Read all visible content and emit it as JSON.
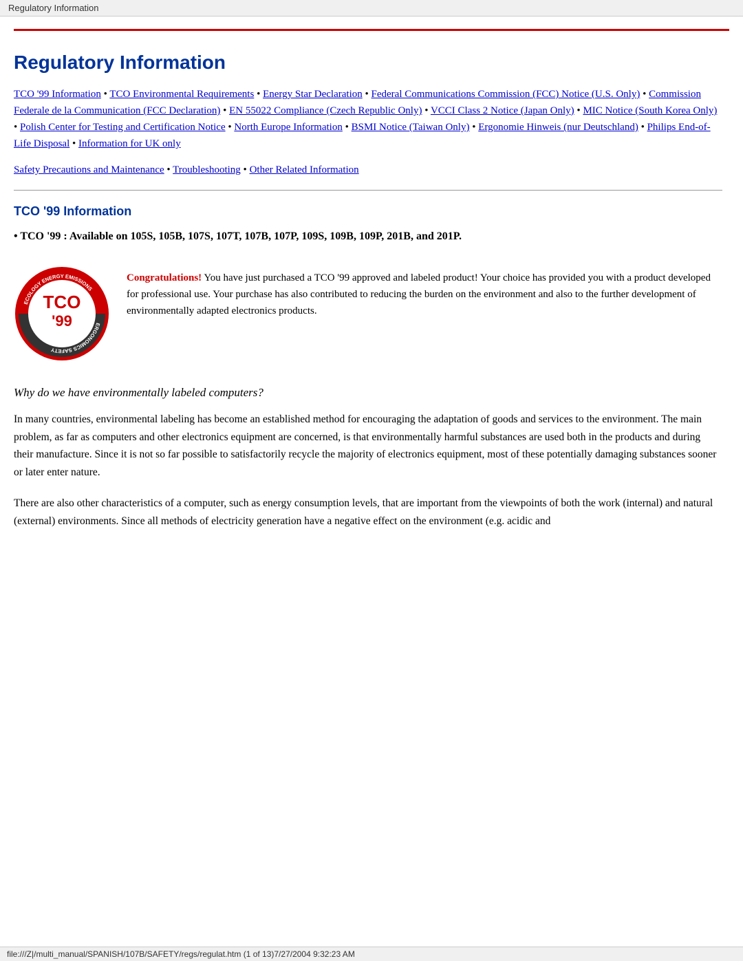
{
  "browser_tab": {
    "title": "Regulatory Information"
  },
  "page": {
    "title": "Regulatory Information",
    "nav_links": [
      {
        "label": "TCO '99 Information",
        "href": "#tco99"
      },
      {
        "label": "TCO Environmental Requirements",
        "href": "#tco-env"
      },
      {
        "label": "Energy Star Declaration",
        "href": "#energy-star"
      },
      {
        "label": "Federal Communications Commission (FCC) Notice (U.S. Only)",
        "href": "#fcc"
      },
      {
        "label": "Commission Federale de la Communication (FCC Declaration)",
        "href": "#fcc-decl"
      },
      {
        "label": "EN 55022 Compliance (Czech Republic Only)",
        "href": "#en55022"
      },
      {
        "label": "VCCI Class 2 Notice (Japan Only)",
        "href": "#vcci"
      },
      {
        "label": "MIC Notice (South Korea Only)",
        "href": "#mic"
      },
      {
        "label": "Polish Center for Testing and Certification Notice",
        "href": "#polish"
      },
      {
        "label": "North Europe Information",
        "href": "#north-europe"
      },
      {
        "label": "BSMI Notice (Taiwan Only)",
        "href": "#bsmi"
      },
      {
        "label": "Ergonomie Hinweis (nur Deutschland)",
        "href": "#ergonomie"
      },
      {
        "label": "Philips End-of-Life Disposal",
        "href": "#philips"
      },
      {
        "label": "Information for UK only",
        "href": "#uk"
      }
    ],
    "secondary_links": [
      {
        "label": "Safety Precautions and Maintenance",
        "href": "#safety"
      },
      {
        "label": "Troubleshooting",
        "href": "#troubleshooting"
      },
      {
        "label": "Other Related Information",
        "href": "#other"
      }
    ],
    "tco_section": {
      "title": "TCO '99 Information",
      "notice": "• TCO '99 : Available on 105S, 105B, 107S, 107T, 107B, 107P, 109S, 109B, 109P, 201B, and 201P.",
      "congrats_label": "Congratulations!",
      "congrats_text": " You have just purchased a TCO '99 approved and labeled product! Your choice has provided you with a product developed for professional use. Your purchase has also contributed to reducing the burden on the environment and also to the further development of environmentally adapted electronics products.",
      "italic_heading": "Why do we have environmentally labeled computers?",
      "paragraph1": "In many countries, environmental labeling has become an established method for encouraging the adaptation of goods and services to the environment. The main problem, as far as computers and other electronics equipment are concerned, is that environmentally harmful substances are used both in the products and during their manufacture. Since it is not so far possible to satisfactorily recycle the majority of electronics equipment, most of these potentially damaging substances sooner or later enter nature.",
      "paragraph2": "There are also other characteristics of a computer, such as energy consumption levels, that are important from the viewpoints of both the work (internal) and natural (external) environments. Since all methods of electricity generation have a negative effect on the environment (e.g. acidic and"
    },
    "status_bar": {
      "text": "file:///Z|/multi_manual/SPANISH/107B/SAFETY/regs/regulat.htm (1 of 13)7/27/2004 9:32:23 AM"
    }
  }
}
